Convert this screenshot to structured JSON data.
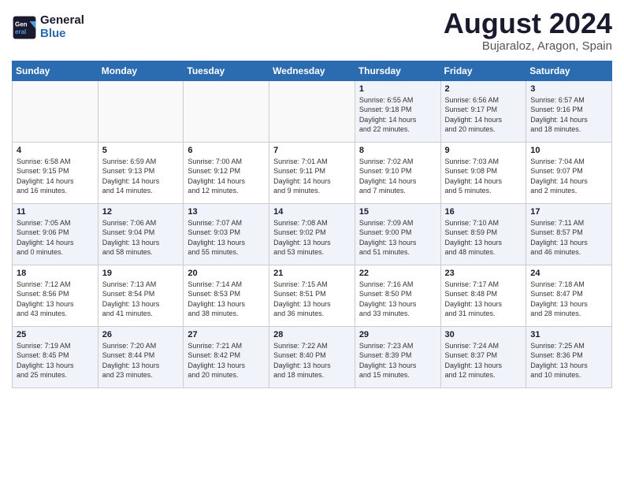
{
  "header": {
    "logo_line1": "General",
    "logo_line2": "Blue",
    "month_title": "August 2024",
    "subtitle": "Bujaraloz, Aragon, Spain"
  },
  "days_of_week": [
    "Sunday",
    "Monday",
    "Tuesday",
    "Wednesday",
    "Thursday",
    "Friday",
    "Saturday"
  ],
  "weeks": [
    [
      {
        "day": "",
        "info": ""
      },
      {
        "day": "",
        "info": ""
      },
      {
        "day": "",
        "info": ""
      },
      {
        "day": "",
        "info": ""
      },
      {
        "day": "1",
        "info": "Sunrise: 6:55 AM\nSunset: 9:18 PM\nDaylight: 14 hours\nand 22 minutes."
      },
      {
        "day": "2",
        "info": "Sunrise: 6:56 AM\nSunset: 9:17 PM\nDaylight: 14 hours\nand 20 minutes."
      },
      {
        "day": "3",
        "info": "Sunrise: 6:57 AM\nSunset: 9:16 PM\nDaylight: 14 hours\nand 18 minutes."
      }
    ],
    [
      {
        "day": "4",
        "info": "Sunrise: 6:58 AM\nSunset: 9:15 PM\nDaylight: 14 hours\nand 16 minutes."
      },
      {
        "day": "5",
        "info": "Sunrise: 6:59 AM\nSunset: 9:13 PM\nDaylight: 14 hours\nand 14 minutes."
      },
      {
        "day": "6",
        "info": "Sunrise: 7:00 AM\nSunset: 9:12 PM\nDaylight: 14 hours\nand 12 minutes."
      },
      {
        "day": "7",
        "info": "Sunrise: 7:01 AM\nSunset: 9:11 PM\nDaylight: 14 hours\nand 9 minutes."
      },
      {
        "day": "8",
        "info": "Sunrise: 7:02 AM\nSunset: 9:10 PM\nDaylight: 14 hours\nand 7 minutes."
      },
      {
        "day": "9",
        "info": "Sunrise: 7:03 AM\nSunset: 9:08 PM\nDaylight: 14 hours\nand 5 minutes."
      },
      {
        "day": "10",
        "info": "Sunrise: 7:04 AM\nSunset: 9:07 PM\nDaylight: 14 hours\nand 2 minutes."
      }
    ],
    [
      {
        "day": "11",
        "info": "Sunrise: 7:05 AM\nSunset: 9:06 PM\nDaylight: 14 hours\nand 0 minutes."
      },
      {
        "day": "12",
        "info": "Sunrise: 7:06 AM\nSunset: 9:04 PM\nDaylight: 13 hours\nand 58 minutes."
      },
      {
        "day": "13",
        "info": "Sunrise: 7:07 AM\nSunset: 9:03 PM\nDaylight: 13 hours\nand 55 minutes."
      },
      {
        "day": "14",
        "info": "Sunrise: 7:08 AM\nSunset: 9:02 PM\nDaylight: 13 hours\nand 53 minutes."
      },
      {
        "day": "15",
        "info": "Sunrise: 7:09 AM\nSunset: 9:00 PM\nDaylight: 13 hours\nand 51 minutes."
      },
      {
        "day": "16",
        "info": "Sunrise: 7:10 AM\nSunset: 8:59 PM\nDaylight: 13 hours\nand 48 minutes."
      },
      {
        "day": "17",
        "info": "Sunrise: 7:11 AM\nSunset: 8:57 PM\nDaylight: 13 hours\nand 46 minutes."
      }
    ],
    [
      {
        "day": "18",
        "info": "Sunrise: 7:12 AM\nSunset: 8:56 PM\nDaylight: 13 hours\nand 43 minutes."
      },
      {
        "day": "19",
        "info": "Sunrise: 7:13 AM\nSunset: 8:54 PM\nDaylight: 13 hours\nand 41 minutes."
      },
      {
        "day": "20",
        "info": "Sunrise: 7:14 AM\nSunset: 8:53 PM\nDaylight: 13 hours\nand 38 minutes."
      },
      {
        "day": "21",
        "info": "Sunrise: 7:15 AM\nSunset: 8:51 PM\nDaylight: 13 hours\nand 36 minutes."
      },
      {
        "day": "22",
        "info": "Sunrise: 7:16 AM\nSunset: 8:50 PM\nDaylight: 13 hours\nand 33 minutes."
      },
      {
        "day": "23",
        "info": "Sunrise: 7:17 AM\nSunset: 8:48 PM\nDaylight: 13 hours\nand 31 minutes."
      },
      {
        "day": "24",
        "info": "Sunrise: 7:18 AM\nSunset: 8:47 PM\nDaylight: 13 hours\nand 28 minutes."
      }
    ],
    [
      {
        "day": "25",
        "info": "Sunrise: 7:19 AM\nSunset: 8:45 PM\nDaylight: 13 hours\nand 25 minutes."
      },
      {
        "day": "26",
        "info": "Sunrise: 7:20 AM\nSunset: 8:44 PM\nDaylight: 13 hours\nand 23 minutes."
      },
      {
        "day": "27",
        "info": "Sunrise: 7:21 AM\nSunset: 8:42 PM\nDaylight: 13 hours\nand 20 minutes."
      },
      {
        "day": "28",
        "info": "Sunrise: 7:22 AM\nSunset: 8:40 PM\nDaylight: 13 hours\nand 18 minutes."
      },
      {
        "day": "29",
        "info": "Sunrise: 7:23 AM\nSunset: 8:39 PM\nDaylight: 13 hours\nand 15 minutes."
      },
      {
        "day": "30",
        "info": "Sunrise: 7:24 AM\nSunset: 8:37 PM\nDaylight: 13 hours\nand 12 minutes."
      },
      {
        "day": "31",
        "info": "Sunrise: 7:25 AM\nSunset: 8:36 PM\nDaylight: 13 hours\nand 10 minutes."
      }
    ]
  ]
}
